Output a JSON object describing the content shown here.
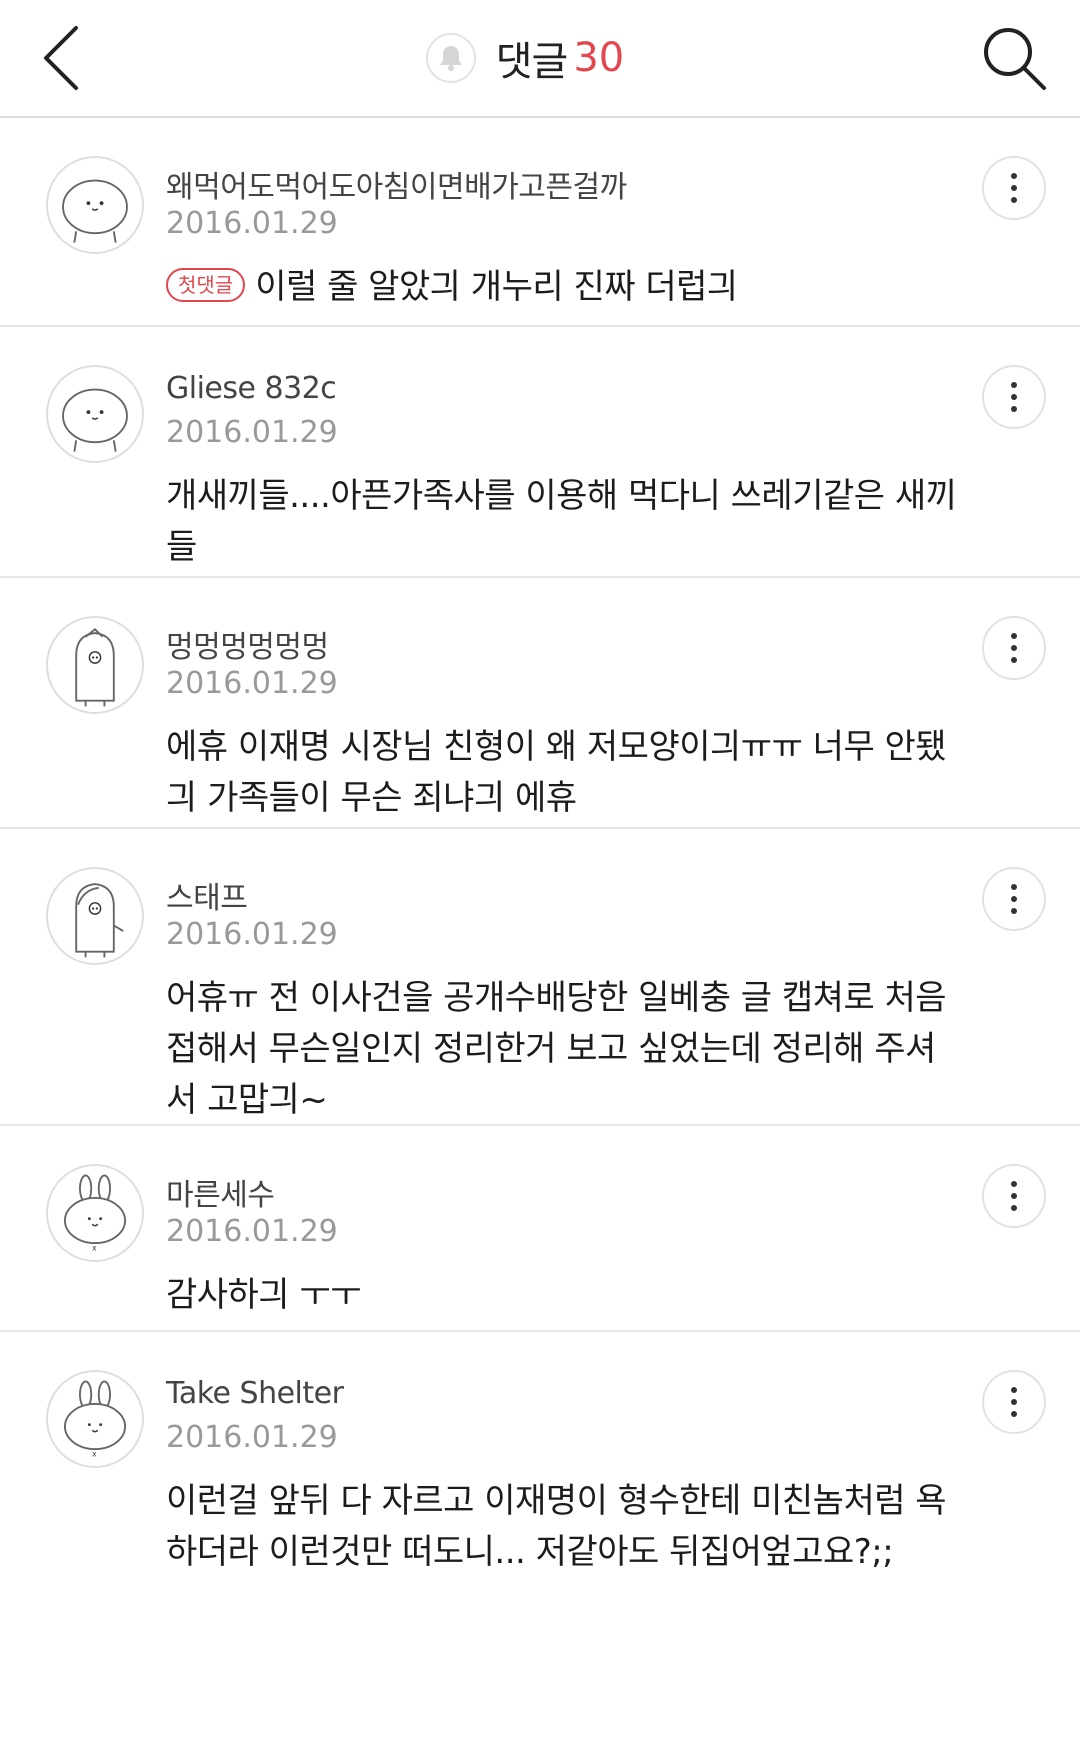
{
  "header": {
    "title": "댓글",
    "count": "30",
    "back_icon": "chevron-left-icon",
    "bell_icon": "bell-icon",
    "search_icon": "search-icon"
  },
  "colors": {
    "accent": "#e2474f",
    "divider": "#e6e6e6",
    "date": "#999999"
  },
  "comments": [
    {
      "nickname": "왜먹어도먹어도아침이면배가고픈걸까",
      "date": "2016.01.29",
      "badge": "첫댓글",
      "avatar_icon": "blob-avatar-icon",
      "lines": [
        "이럴 줄 알았긔 개누리 진짜 더럽긔"
      ]
    },
    {
      "nickname": "Gliese 832c",
      "date": "2016.01.29",
      "badge": "",
      "avatar_icon": "blob-avatar-icon",
      "lines": [
        "개새끼들....아픈가족사를 이용해 먹다니 쓰레기같은 새끼",
        "들"
      ]
    },
    {
      "nickname": "멍멍멍멍멍멍",
      "date": "2016.01.29",
      "badge": "",
      "avatar_icon": "penguin-avatar-icon",
      "lines": [
        "에휴 이재명 시장님 친형이 왜 저모양이긔ㅠㅠ 너무 안됐",
        "긔 가족들이 무슨 죄냐긔 에휴"
      ]
    },
    {
      "nickname": "스태프",
      "date": "2016.01.29",
      "badge": "",
      "avatar_icon": "penguin-avatar-icon",
      "lines": [
        "어휴ㅠ 전 이사건을 공개수배당한 일베충 글 캡쳐로 처음",
        "접해서 무슨일인지 정리한거 보고 싶었는데 정리해 주셔",
        "서 고맙긔~"
      ]
    },
    {
      "nickname": "마른세수",
      "date": "2016.01.29",
      "badge": "",
      "avatar_icon": "rabbit-avatar-icon",
      "lines": [
        "감사하긔 ㅜㅜ"
      ]
    },
    {
      "nickname": "Take Shelter",
      "date": "2016.01.29",
      "badge": "",
      "avatar_icon": "rabbit-avatar-icon",
      "lines": [
        "이런걸 앞뒤 다 자르고 이재명이 형수한테 미친놈처럼 욕",
        "하더라 이런것만 떠도니... 저같아도 뒤집어엎고요?;;"
      ]
    }
  ]
}
